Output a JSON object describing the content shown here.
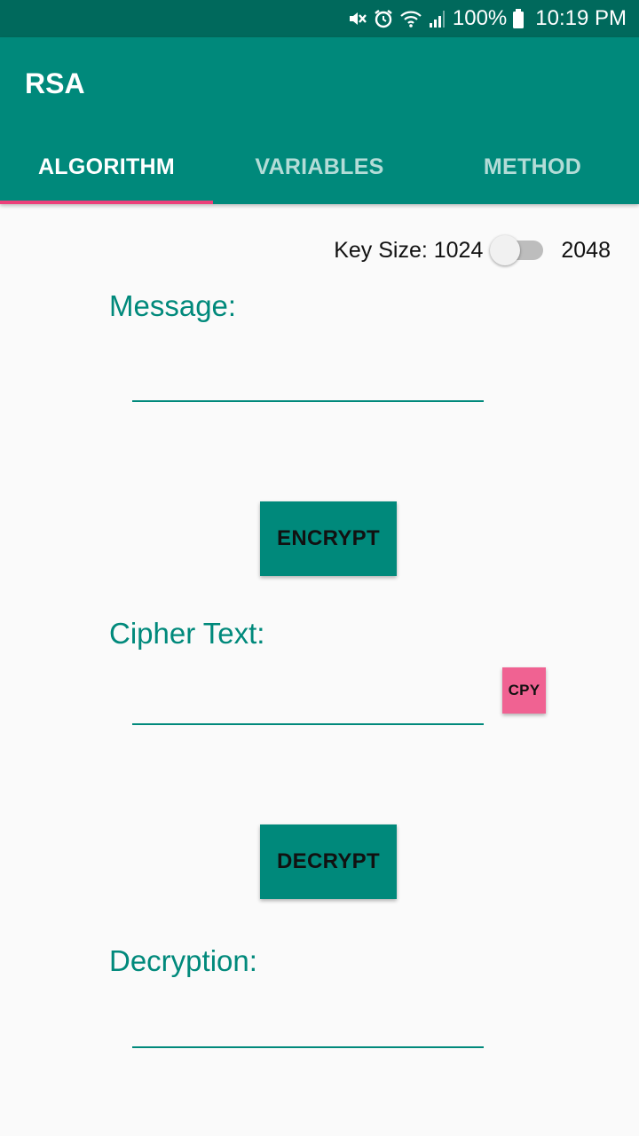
{
  "status_bar": {
    "battery_percent": "100%",
    "time": "10:19 PM",
    "icons": [
      "mute-icon",
      "alarm-icon",
      "wifi-icon",
      "signal-icon",
      "battery-icon"
    ]
  },
  "app_bar": {
    "title": "RSA",
    "tabs": [
      {
        "label": "ALGORITHM",
        "active": true
      },
      {
        "label": "VARIABLES",
        "active": false
      },
      {
        "label": "METHOD",
        "active": false
      }
    ]
  },
  "key_size": {
    "label": "Key Size: 1024",
    "alt_label": "2048",
    "switch_on": false
  },
  "message": {
    "label": "Message:",
    "value": ""
  },
  "encrypt_button": "ENCRYPT",
  "cipher": {
    "label": "Cipher Text:",
    "value": "",
    "copy_label": "CPY"
  },
  "decrypt_button": "DECRYPT",
  "decryption": {
    "label": "Decryption:",
    "value": ""
  },
  "colors": {
    "primary": "#00897b",
    "primary_dark": "#00695c",
    "accent": "#ec407a",
    "copy_button": "#f06292"
  }
}
